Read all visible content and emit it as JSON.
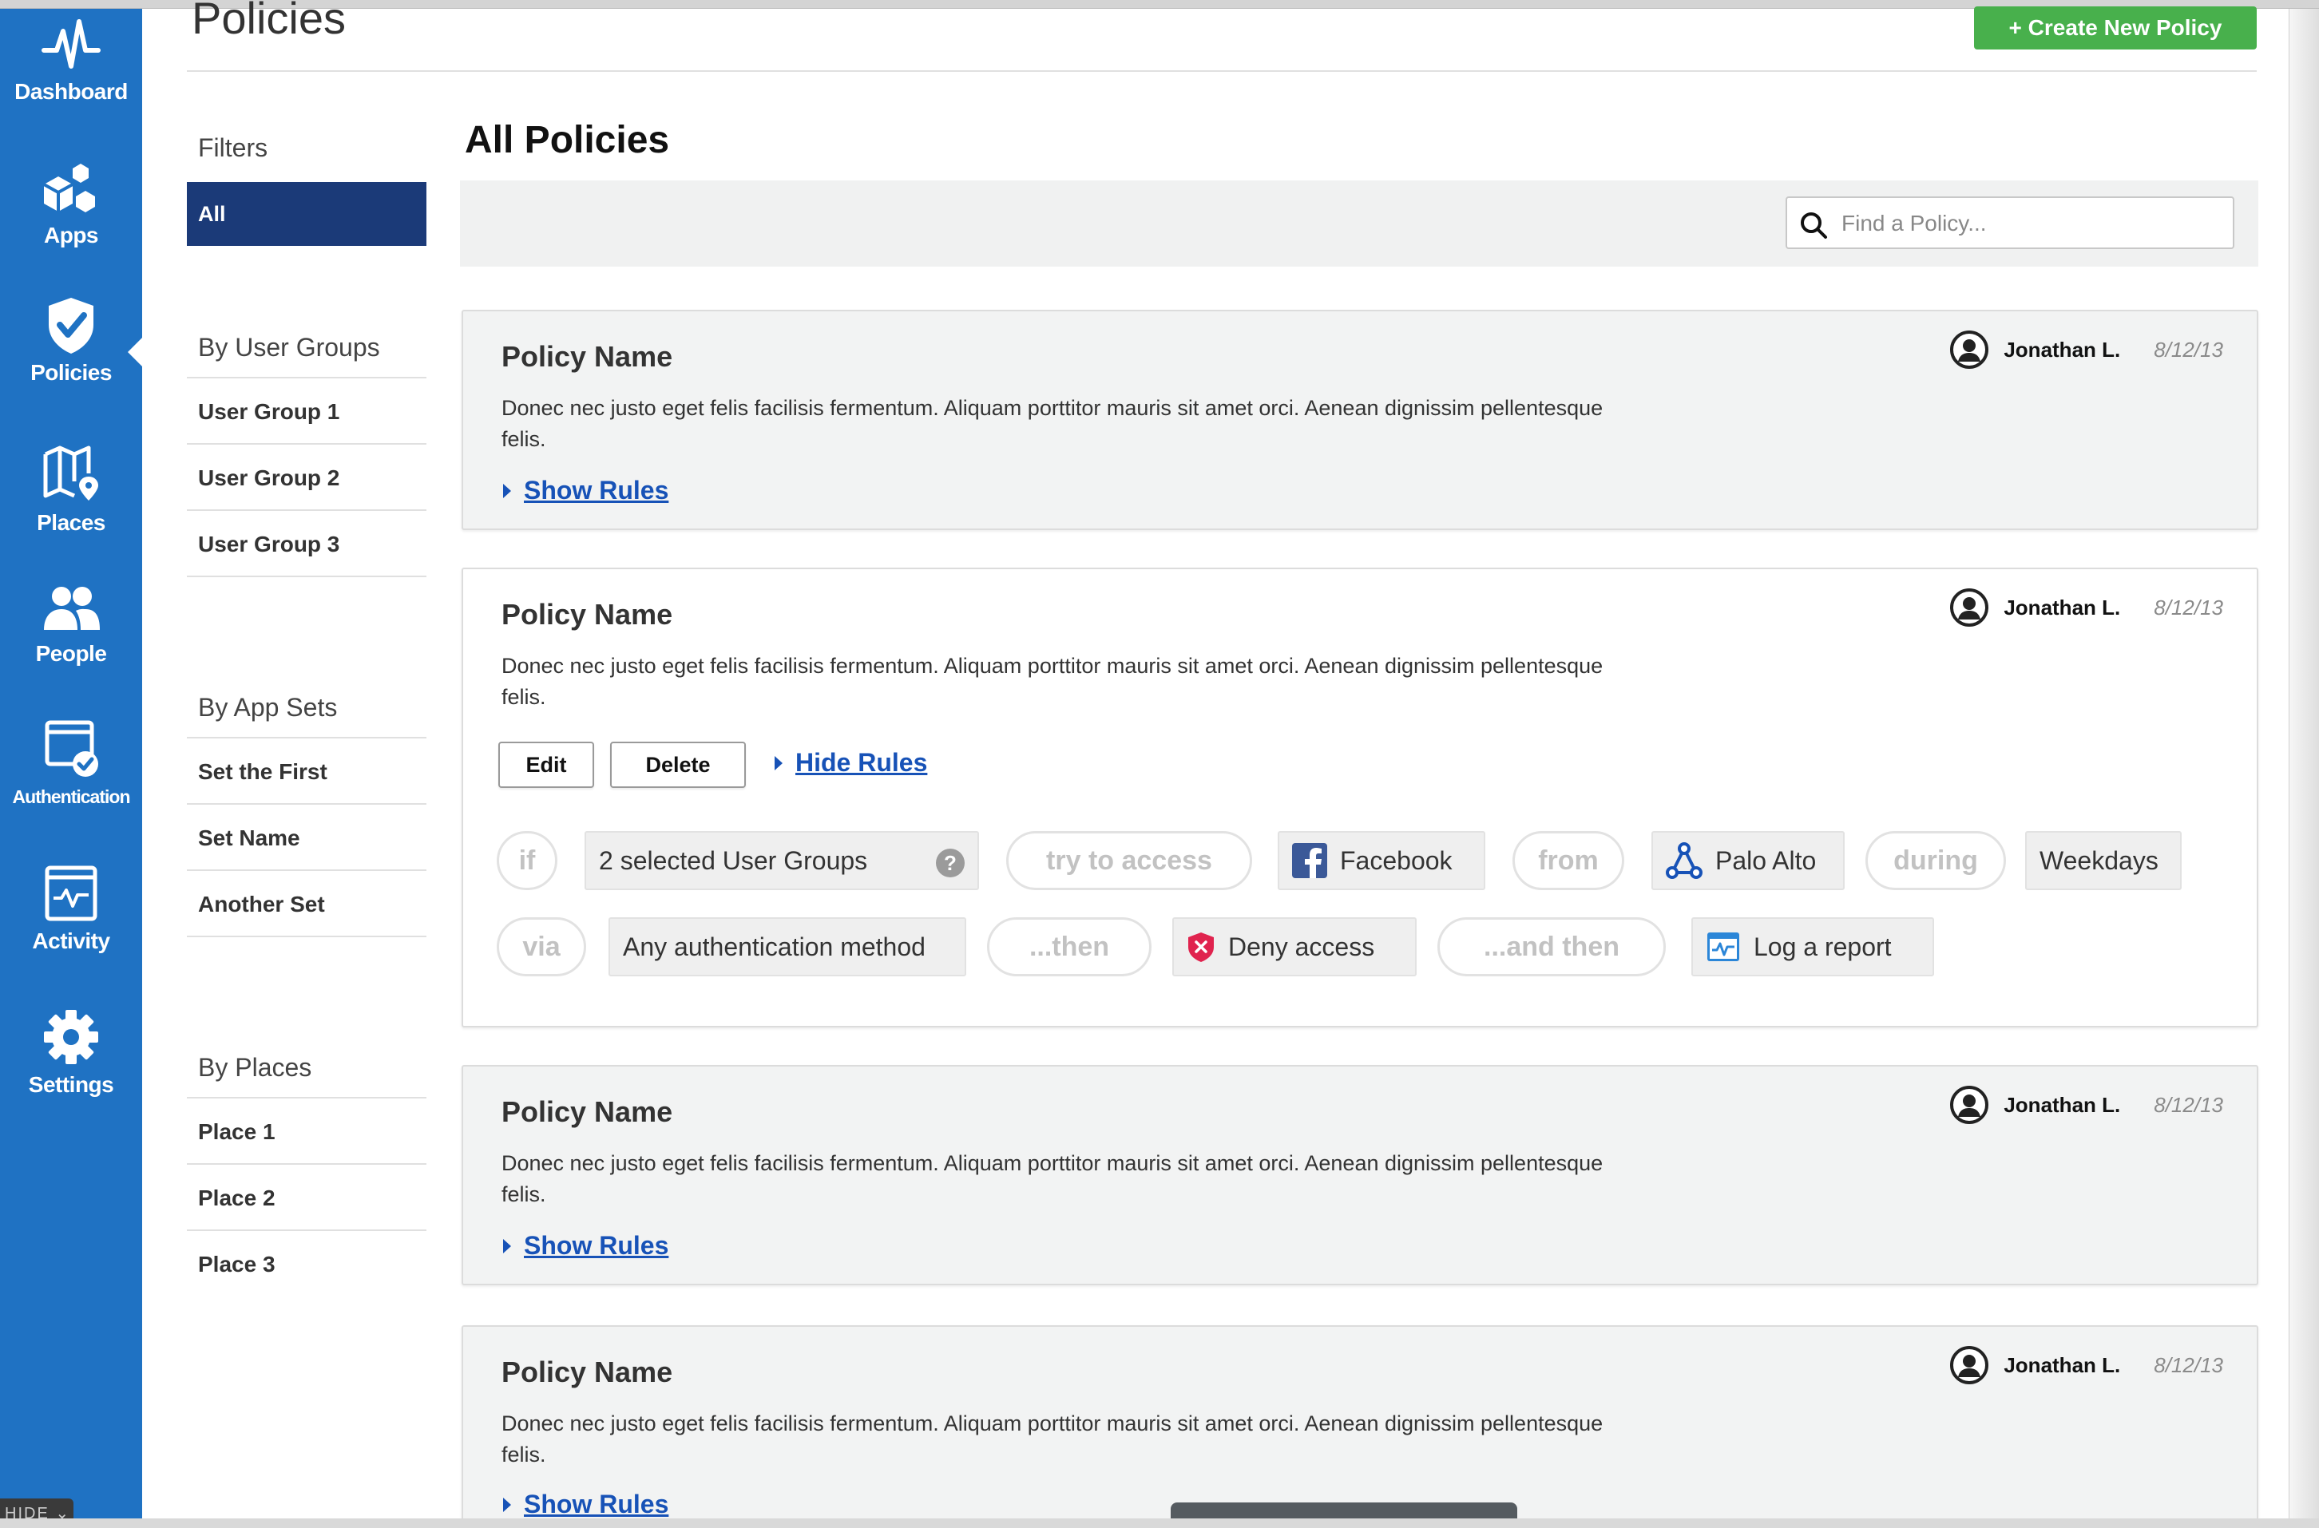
{
  "nav": {
    "items": [
      {
        "label": "Dashboard",
        "icon": "pulse-icon"
      },
      {
        "label": "Apps",
        "icon": "cubes-icon"
      },
      {
        "label": "Policies",
        "icon": "shield-check-icon",
        "active": true
      },
      {
        "label": "Places",
        "icon": "map-pin-icon"
      },
      {
        "label": "People",
        "icon": "people-icon"
      },
      {
        "label": "Authentication",
        "icon": "browser-check-icon"
      },
      {
        "label": "Activity",
        "icon": "monitor-activity-icon"
      },
      {
        "label": "Settings",
        "icon": "gear-icon"
      }
    ],
    "hide_label": "HIDE ⌄"
  },
  "header": {
    "title": "Policies",
    "create_button": "+ Create New Policy"
  },
  "filters": {
    "title": "Filters",
    "all_label": "All",
    "groups": [
      {
        "title": "By User Groups",
        "items": [
          "User Group 1",
          "User Group 2",
          "User Group 3"
        ]
      },
      {
        "title": "By App Sets",
        "items": [
          "Set the First",
          "Set Name",
          "Another Set"
        ]
      },
      {
        "title": "By Places",
        "items": [
          "Place 1",
          "Place 2",
          "Place 3"
        ]
      }
    ]
  },
  "main": {
    "title": "All Policies",
    "search_placeholder": "Find a Policy..."
  },
  "policies": [
    {
      "name": "Policy Name",
      "description": "Donec nec justo eget felis facilisis fermentum. Aliquam porttitor mauris sit amet orci. Aenean dignissim pellentesque felis.",
      "user": "Jonathan L.",
      "date": "8/12/13",
      "rules_link": "Show Rules"
    },
    {
      "name": "Policy Name",
      "description": "Donec nec justo eget felis facilisis fermentum. Aliquam porttitor mauris sit amet orci. Aenean dignissim pellentesque felis.",
      "user": "Jonathan L.",
      "date": "8/12/13",
      "rules_link": "Hide Rules",
      "edit_label": "Edit",
      "delete_label": "Delete"
    },
    {
      "name": "Policy Name",
      "description": "Donec nec justo eget felis facilisis fermentum. Aliquam porttitor mauris sit amet orci. Aenean dignissim pellentesque felis.",
      "user": "Jonathan L.",
      "date": "8/12/13",
      "rules_link": "Show Rules"
    },
    {
      "name": "Policy Name",
      "description": "Donec nec justo eget felis facilisis fermentum. Aliquam porttitor mauris sit amet orci. Aenean dignissim pellentesque felis.",
      "user": "Jonathan L.",
      "date": "8/12/13",
      "rules_link": "Show Rules"
    }
  ],
  "rule": {
    "if": "if",
    "user_groups": "2 selected User Groups",
    "help": "?",
    "try_to_access": "try to access",
    "app": "Facebook",
    "from": "from",
    "place": "Palo Alto",
    "during": "during",
    "time": "Weekdays",
    "via": "via",
    "auth": "Any authentication method",
    "then": "...then",
    "action": "Deny access",
    "and_then": "...and then",
    "followup": "Log a report"
  },
  "colors": {
    "nav_bg": "#1f72c3",
    "filter_active_bg": "#1b3a78",
    "create_button_bg": "#48b04c",
    "link": "#1752b7",
    "deny_red": "#e0234e"
  }
}
